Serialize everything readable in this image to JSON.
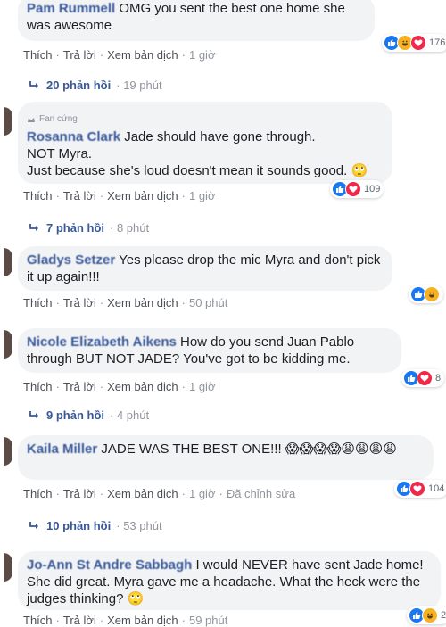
{
  "comments": [
    {
      "author": "Pam Rummell",
      "text": "OMG you sent the best one home she was awesome",
      "actions": {
        "like": "Thích",
        "reply": "Trả lời",
        "translate": "Xem bản dịch",
        "time": "1 giờ"
      },
      "reactions": {
        "types": [
          "like",
          "haha",
          "love"
        ],
        "count": "176"
      },
      "replies": {
        "label": "20 phản hồi",
        "time": "19 phút"
      }
    },
    {
      "badge": "Fan cứng",
      "author": "Rosanna Clark",
      "text_lines": [
        "Jade should have gone through.",
        "NOT Myra.",
        "Just because she's loud doesn't mean it sounds good. 🙄"
      ],
      "actions": {
        "like": "Thích",
        "reply": "Trả lời",
        "translate": "Xem bản dịch",
        "time": "1 giờ"
      },
      "reactions": {
        "types": [
          "like",
          "love"
        ],
        "count": "109"
      },
      "replies": {
        "label": "7 phản hồi",
        "time": "8 phút"
      }
    },
    {
      "author": "Gladys Setzer",
      "text": "Yes please drop the mic Myra and don't pick it up again!!!",
      "actions": {
        "like": "Thích",
        "reply": "Trả lời",
        "translate": "Xem bản dịch",
        "time": "50 phút"
      },
      "reactions": {
        "types": [
          "like",
          "haha"
        ],
        "count": ""
      }
    },
    {
      "author": "Nicole Elizabeth Aikens",
      "text": "How do you send Juan Pablo through BUT NOT JADE? You've got to be kidding me.",
      "actions": {
        "like": "Thích",
        "reply": "Trả lời",
        "translate": "Xem bản dịch",
        "time": "1 giờ"
      },
      "reactions": {
        "types": [
          "like",
          "love"
        ],
        "count": "8"
      },
      "replies": {
        "label": "9 phản hồi",
        "time": "4 phút"
      }
    },
    {
      "author": "Kaila Miller",
      "text": "JADE WAS THE BEST ONE!!! 😱😱😱😱😩😩😩😩",
      "actions": {
        "like": "Thích",
        "reply": "Trả lời",
        "translate": "Xem bản dịch",
        "time": "1 giờ",
        "edited": "Đã chỉnh sửa"
      },
      "reactions": {
        "types": [
          "like",
          "love"
        ],
        "count": "104"
      },
      "replies": {
        "label": "10 phản hồi",
        "time": "53 phút"
      }
    },
    {
      "author": "Jo-Ann St Andre Sabbagh",
      "text": "I would NEVER have sent Jade home! She did great. Myra gave me a headache. What the heck were the judges thinking? 🙄",
      "actions": {
        "like": "Thích",
        "reply": "Trả lời",
        "translate": "Xem bản dịch",
        "time": "59 phút"
      },
      "reactions": {
        "types": [
          "like",
          "haha"
        ],
        "count": "2"
      }
    }
  ],
  "colors": {
    "link": "#385898",
    "bubble": "#f2f3f5",
    "like": "#1877f2",
    "love": "#f0284a",
    "haha": "#f7b125"
  }
}
